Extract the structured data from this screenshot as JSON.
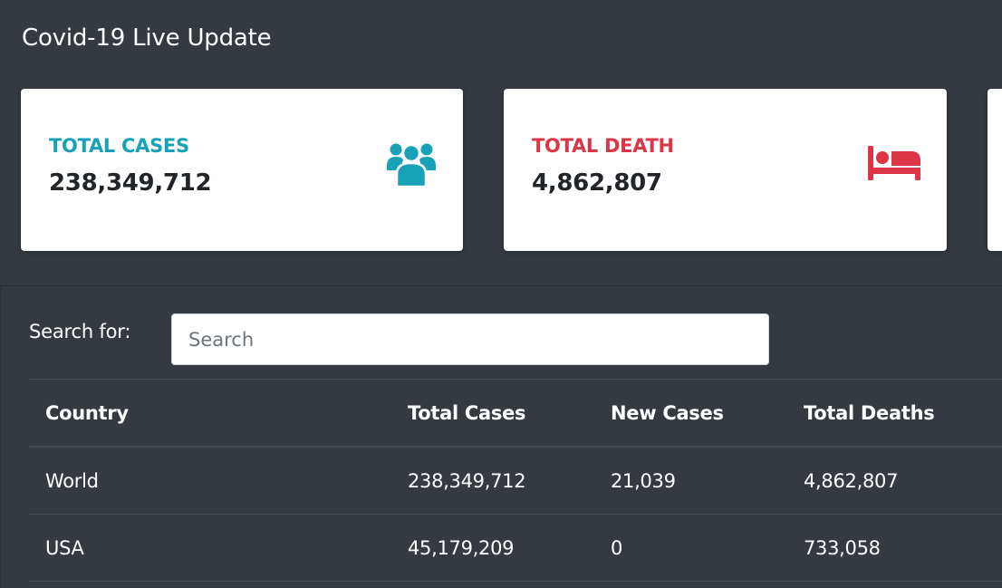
{
  "header": {
    "title": "Covid-19 Live Update"
  },
  "cards": {
    "cases": {
      "label": "TOTAL CASES",
      "value": "238,349,712",
      "icon": "users-icon",
      "color": "#17a2b8"
    },
    "death": {
      "label": "TOTAL DEATH",
      "value": "4,862,807",
      "icon": "bed-icon",
      "color": "#dc3545"
    }
  },
  "search": {
    "label": "Search for:",
    "placeholder": "Search",
    "value": ""
  },
  "table": {
    "columns": {
      "country": "Country",
      "total_cases": "Total Cases",
      "new_cases": "New Cases",
      "total_deaths": "Total Deaths"
    },
    "rows": [
      {
        "country": "World",
        "total_cases": "238,349,712",
        "new_cases": "21,039",
        "total_deaths": "4,862,807"
      },
      {
        "country": "USA",
        "total_cases": "45,179,209",
        "new_cases": "0",
        "total_deaths": "733,058"
      }
    ]
  },
  "colors": {
    "background": "#343a40",
    "card": "#ffffff",
    "cases_accent": "#17a2b8",
    "death_accent": "#dc3545"
  }
}
